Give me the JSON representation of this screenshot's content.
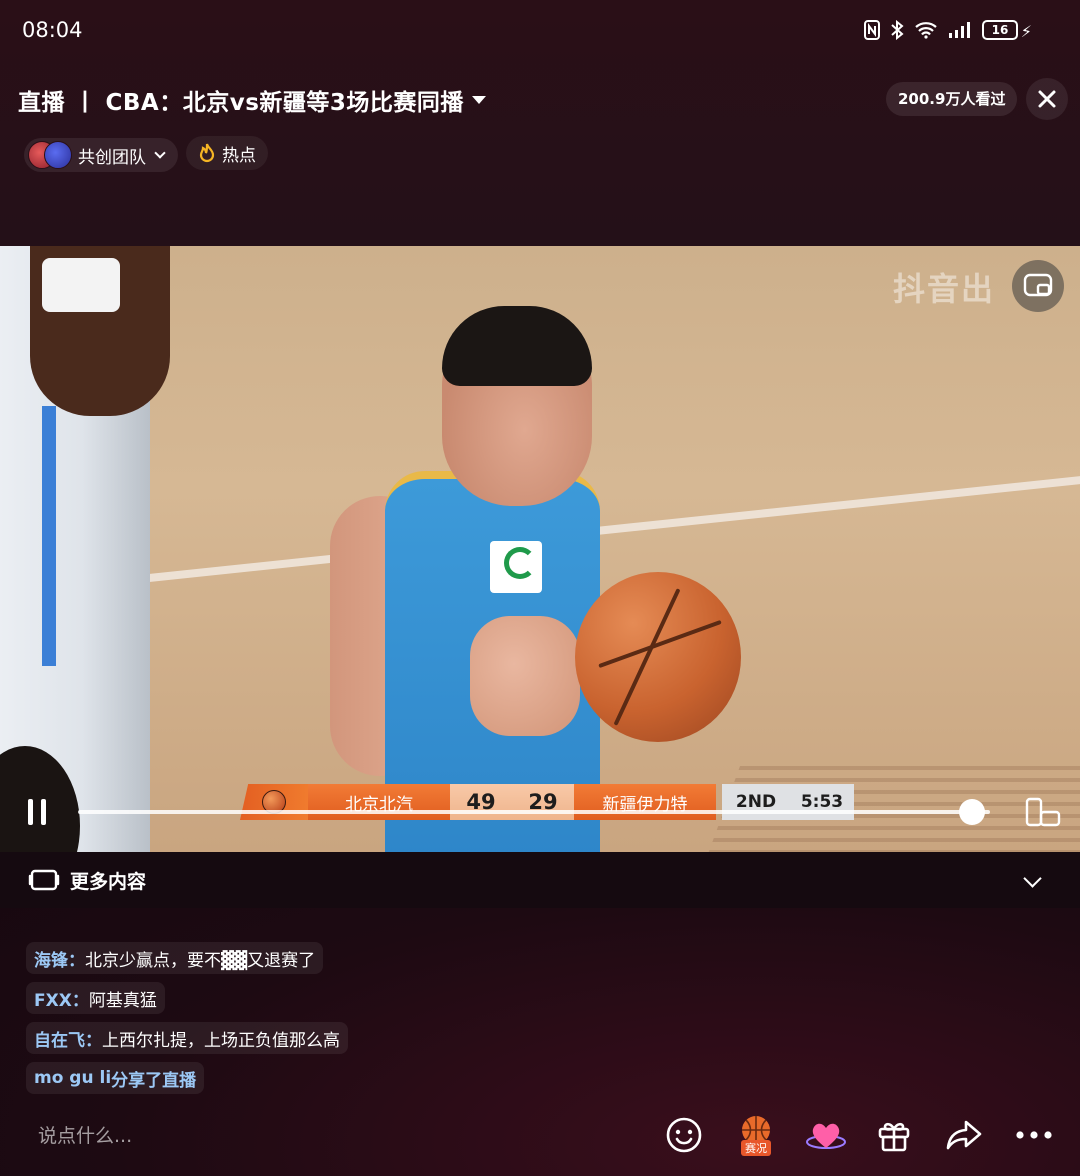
{
  "status_bar": {
    "time": "08:04",
    "battery": "16"
  },
  "header": {
    "title": "直播 丨 CBA：北京vs新疆等3场比赛同播",
    "viewers": "200.9万人看过",
    "team_label": "共创团队",
    "hot_label": "热点"
  },
  "video": {
    "watermark": "抖音出",
    "scoreboard": {
      "home_team": "北京北汽",
      "home_score": "49",
      "away_score": "29",
      "away_team": "新疆伊力特",
      "period": "2ND",
      "clock": "5:53"
    },
    "progress_fraction": 0.98
  },
  "more_content": {
    "label": "更多内容"
  },
  "comments": [
    {
      "user": "海锋：",
      "text": "北京少赢点，要不▓▓又退赛了"
    },
    {
      "user": "FXX：",
      "text": "阿基真猛"
    },
    {
      "user": "自在飞：",
      "text": "上西尔扎提，上场正负值那么高"
    },
    {
      "user": "mo gu li",
      "text": " 分享了直播"
    }
  ],
  "bottom_bar": {
    "input_placeholder": "说点什么...",
    "score_action_label": "赛况"
  },
  "colors": {
    "accent_orange": "#e8572b",
    "username_blue": "#9cc8f5",
    "background": "#1c0a10"
  }
}
